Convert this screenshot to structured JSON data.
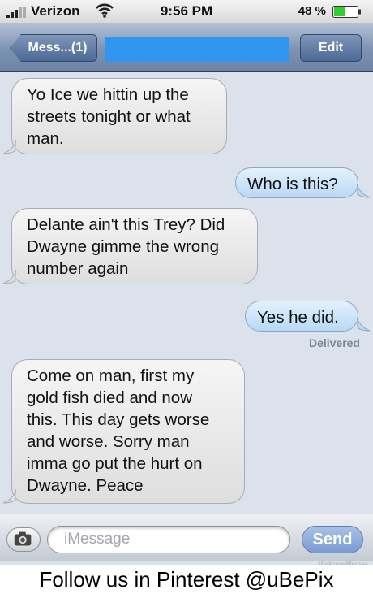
{
  "status_bar": {
    "carrier": "Verizon",
    "time": "9:56 PM",
    "battery": "48 %"
  },
  "nav": {
    "back_label": "Mess...(1)",
    "edit_label": "Edit"
  },
  "messages": [
    {
      "side": "in",
      "text": "Yo Ice we hittin up the\nstreets tonight or what\nman."
    },
    {
      "side": "out",
      "text": "Who is this?"
    },
    {
      "side": "in",
      "text": "Delante ain't this Trey? Did\n Dwayne gimme the wrong\nnumber again"
    },
    {
      "side": "out",
      "text": "Yes he did."
    },
    {
      "side": "in",
      "text": "Come on man, first my\ngold fish died and now\nthis. This day gets worse\nand worse. Sorry man\nimma go put the hurt on\nDwayne. Peace"
    }
  ],
  "delivered_label": "Delivered",
  "input": {
    "placeholder": "iMessage",
    "send_label": "Send"
  },
  "watermark": "WeKnowMemes",
  "footer": "Follow us in Pinterest @uBePix",
  "colors": {
    "redacted_title": "#2f95ee",
    "nav_gradient_top": "#b3c2d6",
    "outgoing_bubble": "#cfe6fb",
    "incoming_bubble": "#ececec"
  }
}
